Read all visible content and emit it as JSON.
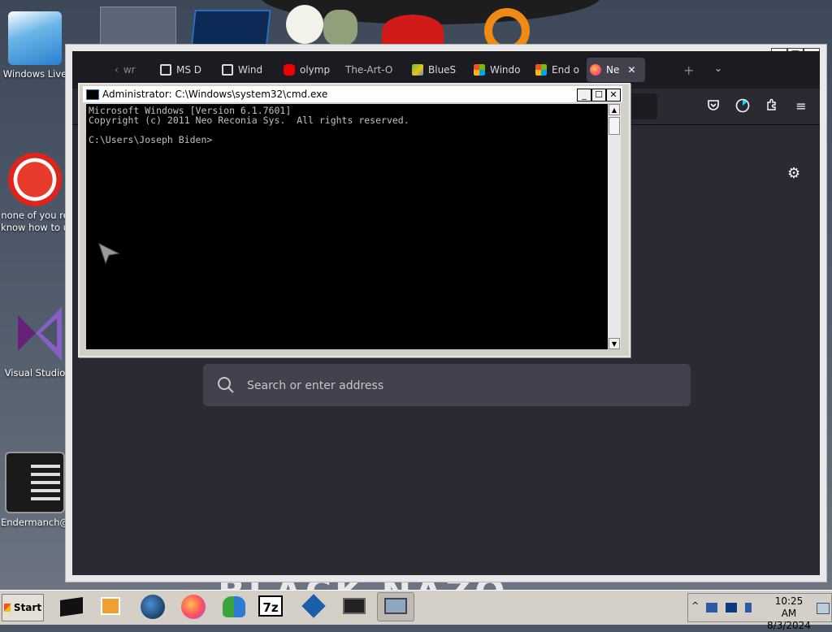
{
  "desktop": {
    "icons": [
      {
        "label": "Windows Live",
        "name": "windows-live"
      },
      {
        "label": "none of you re",
        "label2": "know how to u",
        "name": "dragon-app"
      },
      {
        "label": "Visual Studio",
        "name": "visual-studio"
      },
      {
        "label": "Endermanch@",
        "name": "endermanch"
      }
    ],
    "wallpaper_text": "BLACK NAZO"
  },
  "browser": {
    "tabs": [
      {
        "label": "wr",
        "name": "tab-wr",
        "icon": "back-arrow-icon"
      },
      {
        "label": "MS D",
        "name": "tab-ms",
        "icon": "museum-icon"
      },
      {
        "label": "Wind",
        "name": "tab-wind1",
        "icon": "museum-icon"
      },
      {
        "label": "olymp",
        "name": "tab-olymp",
        "icon": "youtube-icon"
      },
      {
        "label": "The-Art-O",
        "name": "tab-art",
        "icon": ""
      },
      {
        "label": "BlueS",
        "name": "tab-blues",
        "icon": "bluestacks-icon"
      },
      {
        "label": "Windo",
        "name": "tab-windo",
        "icon": "windows-icon"
      },
      {
        "label": "End o",
        "name": "tab-end",
        "icon": "windows-icon"
      },
      {
        "label": "Ne",
        "name": "tab-new",
        "icon": "firefox-icon",
        "active": true
      }
    ],
    "search_placeholder": "Search or enter address",
    "win_min": "_",
    "win_max": "☐",
    "win_close": "✕"
  },
  "cmd": {
    "title": "Administrator: C:\\Windows\\system32\\cmd.exe",
    "lines": [
      "Microsoft Windows [Version 6.1.7601]",
      "Copyright (c) 2011 Neo Reconia Sys.  All rights reserved.",
      "",
      "C:\\Users\\Joseph Biden>"
    ]
  },
  "taskbar": {
    "start_label": "Start",
    "apps": [
      "terminal-app",
      "media-player",
      "globe-app",
      "firefox",
      "msn-messenger",
      "7zip",
      "virtualbox",
      "screen-app",
      "window-app"
    ],
    "seven_zip_label": "7z",
    "time": "10:25 AM",
    "date": "8/3/2024"
  }
}
